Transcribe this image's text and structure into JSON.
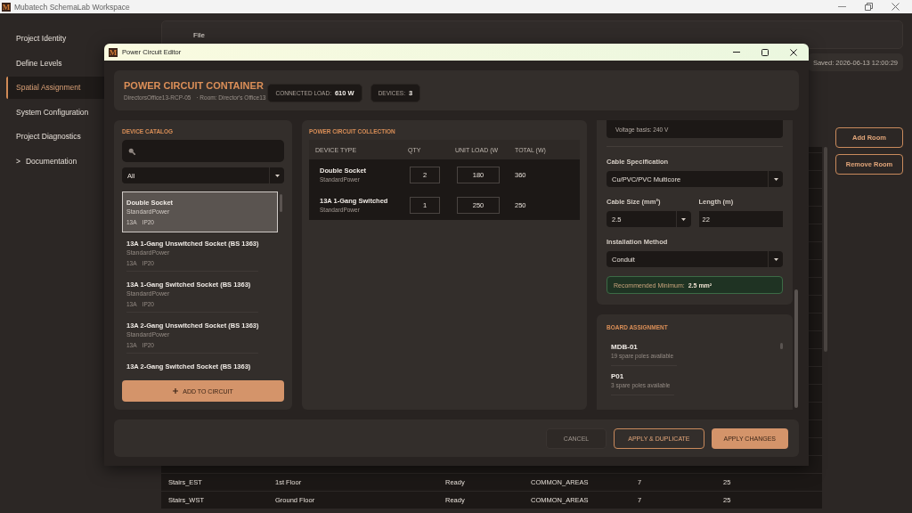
{
  "window": {
    "logo": "M",
    "title": "Mubatech SchemaLab Workspace"
  },
  "sidebar": {
    "items": [
      {
        "label": "Project Identity",
        "selected": false
      },
      {
        "label": "Define Levels",
        "selected": false
      },
      {
        "label": "Spatial Assignment",
        "selected": true
      },
      {
        "label": "System Configuration",
        "selected": false
      },
      {
        "label": "Project Diagnostics",
        "selected": false
      },
      {
        "label": "Documentation",
        "selected": false,
        "toggle": ">"
      }
    ]
  },
  "menu": [
    "File"
  ],
  "save_status": "Saved: 2026-06-13 12:00:29",
  "table": {
    "rows": [
      {
        "cells": [
          "Stairs_EST",
          "1st Floor",
          "Ready",
          "COMMON_AREAS",
          "7",
          "25"
        ]
      },
      {
        "cells": [
          "Stairs_WST",
          "Ground Floor",
          "Ready",
          "COMMON_AREAS",
          "7",
          "25"
        ]
      }
    ]
  },
  "room_buttons": [
    "Add Room",
    "Remove Room"
  ],
  "dialog": {
    "logo": "M",
    "title": "Power Circuit Editor",
    "header": {
      "title": "POWER CIRCUIT CONTAINER",
      "circuit_id": "DirectorsOffice13-RCP-05",
      "room": "· Room: Director's Office13",
      "chips": [
        {
          "label": "CONNECTED LOAD:",
          "value": "610 W"
        },
        {
          "label": "DEVICES:",
          "value": "3"
        }
      ]
    },
    "catalog": {
      "heading": "DEVICE CATALOG",
      "filter": "All",
      "items": [
        {
          "name": "Double Socket",
          "category": "StandardPower",
          "tags": [
            "13A",
            "IP20"
          ],
          "selected": true
        },
        {
          "name": "13A 1-Gang Unswitched Socket (BS 1363)",
          "category": "StandardPower",
          "tags": [
            "13A",
            "IP20"
          ],
          "selected": false
        },
        {
          "name": "13A 1-Gang Switched Socket (BS 1363)",
          "category": "StandardPower",
          "tags": [
            "13A",
            "IP20"
          ],
          "selected": false
        },
        {
          "name": "13A 2-Gang Unswitched Socket (BS 1363)",
          "category": "StandardPower",
          "tags": [
            "13A",
            "IP20"
          ],
          "selected": false
        },
        {
          "name": "13A 2-Gang Switched Socket (BS 1363)",
          "selected": false
        }
      ],
      "add_button": "ADD TO CIRCUIT"
    },
    "collection": {
      "heading": "POWER CIRCUIT COLLECTION",
      "columns": [
        "DEVICE TYPE",
        "QTY",
        "UNIT LOAD (W",
        "TOTAL (W)"
      ],
      "rows": [
        {
          "name": "Double Socket",
          "category": "StandardPower",
          "qty": "2",
          "unit_load": "180",
          "total": "360"
        },
        {
          "name": "13A 1-Gang Switched",
          "category": "StandardPower",
          "qty": "1",
          "unit_load": "250",
          "total": "250"
        }
      ]
    },
    "cable": {
      "note": "Voltage basis: 240 V",
      "field_rows": [
        [
          {
            "kind": "select",
            "label": "Cable Specification",
            "value": "Cu/PVC/PVC Multicore"
          }
        ],
        [
          {
            "kind": "select",
            "label": "Cable Size (mm²)",
            "value": "2.5"
          },
          {
            "kind": "input",
            "label": "Length (m)",
            "value": "22"
          }
        ],
        [
          {
            "kind": "select",
            "label": "Installation Method",
            "value": "Conduit"
          }
        ]
      ],
      "recommendation": "Recommended Minimum: **2.5 mm²**"
    },
    "board": {
      "heading": "BOARD ASSIGNMENT",
      "items": [
        {
          "name": "MDB-01",
          "detail": "19 spare poles available"
        },
        {
          "name": "P01",
          "detail": "3 spare poles available"
        }
      ]
    },
    "footer_buttons": [
      {
        "kind": "secondary",
        "label": "CANCEL"
      },
      {
        "kind": "outline",
        "label": "APPLY & DUPLICATE"
      },
      {
        "kind": "primary",
        "label": "APPLY CHANGES"
      }
    ]
  }
}
